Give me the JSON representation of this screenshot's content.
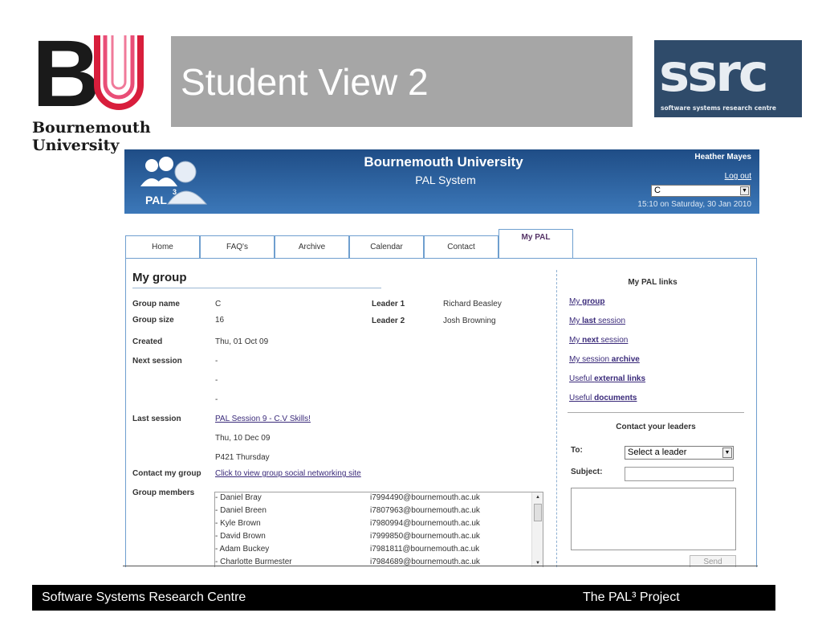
{
  "slide": {
    "title": "Student View 2",
    "logo_left": {
      "letters": "BU",
      "name_line1": "Bournemouth",
      "name_line2": "University"
    },
    "logo_right": {
      "text": "ssrc",
      "subtitle": "software systems research centre"
    },
    "footer": {
      "left": "Software Systems Research Centre",
      "right": "The PAL³ Project"
    }
  },
  "app": {
    "header": {
      "logo_text": "PAL",
      "logo_sup": "3",
      "title": "Bournemouth University",
      "subtitle": "PAL System",
      "user": "Heather Mayes",
      "logout": "Log out",
      "group_select": "C",
      "timestamp": "15:10 on Saturday, 30 Jan 2010"
    },
    "tabs": [
      "Home",
      "FAQ's",
      "Archive",
      "Calendar",
      "Contact",
      "My PAL"
    ],
    "active_tab": "My PAL",
    "section_title": "My group",
    "group": {
      "name_label": "Group name",
      "name": "C",
      "size_label": "Group size",
      "size": "16",
      "leader1_label": "Leader 1",
      "leader1": "Richard Beasley",
      "leader2_label": "Leader 2",
      "leader2": "Josh Browning",
      "created_label": "Created",
      "created": "Thu, 01 Oct 09",
      "next_label": "Next session",
      "next_lines": [
        "-",
        "-",
        "-"
      ],
      "last_label": "Last session",
      "last_link": "PAL Session 9 - C.V Skills!",
      "last_date": "Thu, 10 Dec 09",
      "last_room": "P421 Thursday",
      "contact_label": "Contact my group",
      "contact_link": "Click to view group social networking site",
      "members_label": "Group members"
    },
    "members": [
      {
        "name": "- Daniel Bray",
        "email": "i7994490@bournemouth.ac.uk"
      },
      {
        "name": "- Daniel Breen",
        "email": "i7807963@bournemouth.ac.uk"
      },
      {
        "name": "- Kyle Brown",
        "email": "i7980994@bournemouth.ac.uk"
      },
      {
        "name": "- David Brown",
        "email": "i7999850@bournemouth.ac.uk"
      },
      {
        "name": "- Adam Buckey",
        "email": "i7981811@bournemouth.ac.uk"
      },
      {
        "name": "- Charlotte Burmester",
        "email": "i7984689@bournemouth.ac.uk"
      }
    ],
    "sidebar": {
      "title": "My PAL links",
      "links": [
        {
          "pre": "My ",
          "bold": "group",
          "post": ""
        },
        {
          "pre": "My ",
          "bold": "last",
          "post": " session"
        },
        {
          "pre": "My ",
          "bold": "next",
          "post": " session"
        },
        {
          "pre": "My session ",
          "bold": "archive",
          "post": ""
        },
        {
          "pre": "Useful ",
          "bold": "external links",
          "post": ""
        },
        {
          "pre": "Useful ",
          "bold": "documents",
          "post": ""
        }
      ],
      "contact_title": "Contact your leaders",
      "to_label": "To:",
      "to_value": "Select a leader",
      "subject_label": "Subject:",
      "send_label": "Send"
    }
  },
  "colors": {
    "title_box": "#a6a6a6",
    "bu_red": "#d81e3c",
    "bu_pink": "#e94e77",
    "header_top": "#1f4d86",
    "header_bottom": "#3c78b9",
    "link": "#3a2a7a",
    "ssrc_bg": "#2f4b6a"
  }
}
